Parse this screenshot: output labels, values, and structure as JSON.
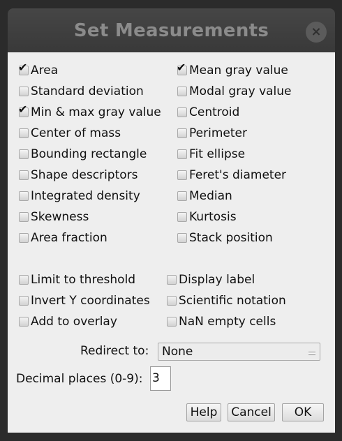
{
  "dialog": {
    "title": "Set Measurements",
    "close_icon": "×"
  },
  "measurements": [
    {
      "label": "Area",
      "checked": true
    },
    {
      "label": "Mean gray value",
      "checked": true
    },
    {
      "label": "Standard deviation",
      "checked": false
    },
    {
      "label": "Modal gray value",
      "checked": false
    },
    {
      "label": "Min & max gray value",
      "checked": true
    },
    {
      "label": "Centroid",
      "checked": false
    },
    {
      "label": "Center of mass",
      "checked": false
    },
    {
      "label": "Perimeter",
      "checked": false
    },
    {
      "label": "Bounding rectangle",
      "checked": false
    },
    {
      "label": "Fit ellipse",
      "checked": false
    },
    {
      "label": "Shape descriptors",
      "checked": false
    },
    {
      "label": "Feret's diameter",
      "checked": false
    },
    {
      "label": "Integrated density",
      "checked": false
    },
    {
      "label": "Median",
      "checked": false
    },
    {
      "label": "Skewness",
      "checked": false
    },
    {
      "label": "Kurtosis",
      "checked": false
    },
    {
      "label": "Area fraction",
      "checked": false
    },
    {
      "label": "Stack position",
      "checked": false
    }
  ],
  "options": [
    {
      "label": "Limit to threshold",
      "checked": false
    },
    {
      "label": "Display label",
      "checked": false
    },
    {
      "label": "Invert Y coordinates",
      "checked": false
    },
    {
      "label": "Scientific notation",
      "checked": false
    },
    {
      "label": "Add to overlay",
      "checked": false
    },
    {
      "label": "NaN empty cells",
      "checked": false
    }
  ],
  "redirect": {
    "label": "Redirect to:",
    "value": "None"
  },
  "decimal": {
    "label": "Decimal places (0-9):",
    "value": "3"
  },
  "buttons": {
    "help": "Help",
    "cancel": "Cancel",
    "ok": "OK"
  }
}
